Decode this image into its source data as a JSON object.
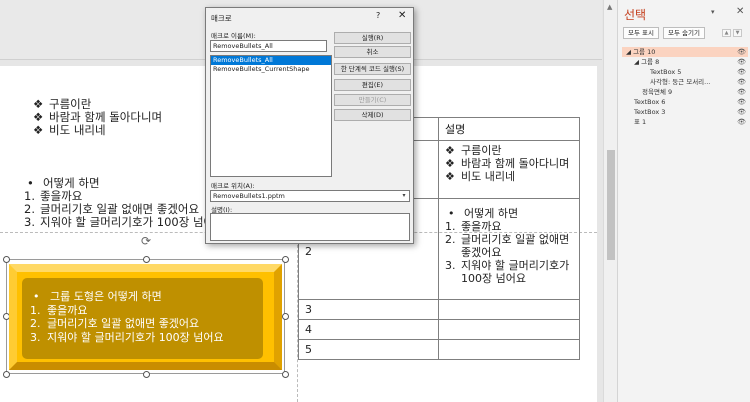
{
  "slide": {
    "top_bullets": [
      {
        "marker": "❖",
        "text": "구름이란"
      },
      {
        "marker": "❖",
        "text": "바람과 함께 돌아다니며"
      },
      {
        "marker": "❖",
        "text": "비도 내리네"
      }
    ],
    "mid_bullets": [
      {
        "marker": "•",
        "text": "어떻게 하면"
      },
      {
        "marker": "1.",
        "text": "좋을까요"
      },
      {
        "marker": "2.",
        "text": "글머리기호 일괄 없애면 좋겠어요"
      },
      {
        "marker": "3.",
        "text": "지워야 할 글머리기호가 100장 넘어요"
      }
    ],
    "table": {
      "header": "설명",
      "row1_items": [
        {
          "marker": "❖",
          "text": "구름이란"
        },
        {
          "marker": "❖",
          "text": "바람과 함께 돌아다니며"
        },
        {
          "marker": "❖",
          "text": "비도 내리네"
        }
      ],
      "row2_num": "2",
      "row2_items": [
        {
          "marker": "•",
          "text": "어떻게 하면"
        },
        {
          "marker": "1.",
          "text": "좋을까요"
        },
        {
          "marker": "2.",
          "text": "글머리기호 일괄 없애면 좋겠어요"
        },
        {
          "marker": "3.",
          "text": "지워야 할 글머리기호가 100장 넘어요"
        }
      ],
      "rows_tail": [
        "3",
        "4",
        "5"
      ]
    },
    "shape_text": [
      {
        "marker": "•",
        "text": "그룹 도형은 어떻게 하면"
      },
      {
        "marker": "1.",
        "text": "좋을까요"
      },
      {
        "marker": "2.",
        "text": "글머리기호 일괄 없애면 좋겠어요"
      },
      {
        "marker": "3.",
        "text": "지워야 할 글머리기호가 100장 넘어요"
      }
    ],
    "shape_colors": {
      "outer": "#ffc000",
      "inner": "#bf9000"
    }
  },
  "dialog": {
    "title": "매크로",
    "help": "?",
    "close": "✕",
    "name_label": "매크로 이름(M):",
    "name_value": "RemoveBullets_All",
    "macros": [
      "RemoveBullets_All",
      "RemoveBullets_CurrentShape"
    ],
    "location_label": "매크로 위치(A):",
    "location_value": "RemoveBullets1.pptm",
    "description_label": "설명(I):",
    "buttons": {
      "run": "실행(R)",
      "cancel": "취소",
      "step": "한 단계씩 코드 실행(S)",
      "edit": "편집(E)",
      "create": "만들기(C)",
      "delete": "삭제(D)"
    }
  },
  "pane": {
    "title": "선택",
    "show_all": "모두 표시",
    "hide_all": "모두 숨기기",
    "items": [
      {
        "label": "그룹 10",
        "prefix": "◢",
        "indent": 0
      },
      {
        "label": "그룹 8",
        "prefix": "◢",
        "indent": 1
      },
      {
        "label": "TextBox 5",
        "prefix": "",
        "indent": 2
      },
      {
        "label": "사각형: 둥근 모서리...",
        "prefix": "",
        "indent": 2
      },
      {
        "label": "정육면체 9",
        "prefix": "",
        "indent": 1
      },
      {
        "label": "TextBox 6",
        "prefix": "",
        "indent": 0
      },
      {
        "label": "TextBox 3",
        "prefix": "",
        "indent": 0
      },
      {
        "label": "표 1",
        "prefix": "",
        "indent": 0
      }
    ]
  }
}
